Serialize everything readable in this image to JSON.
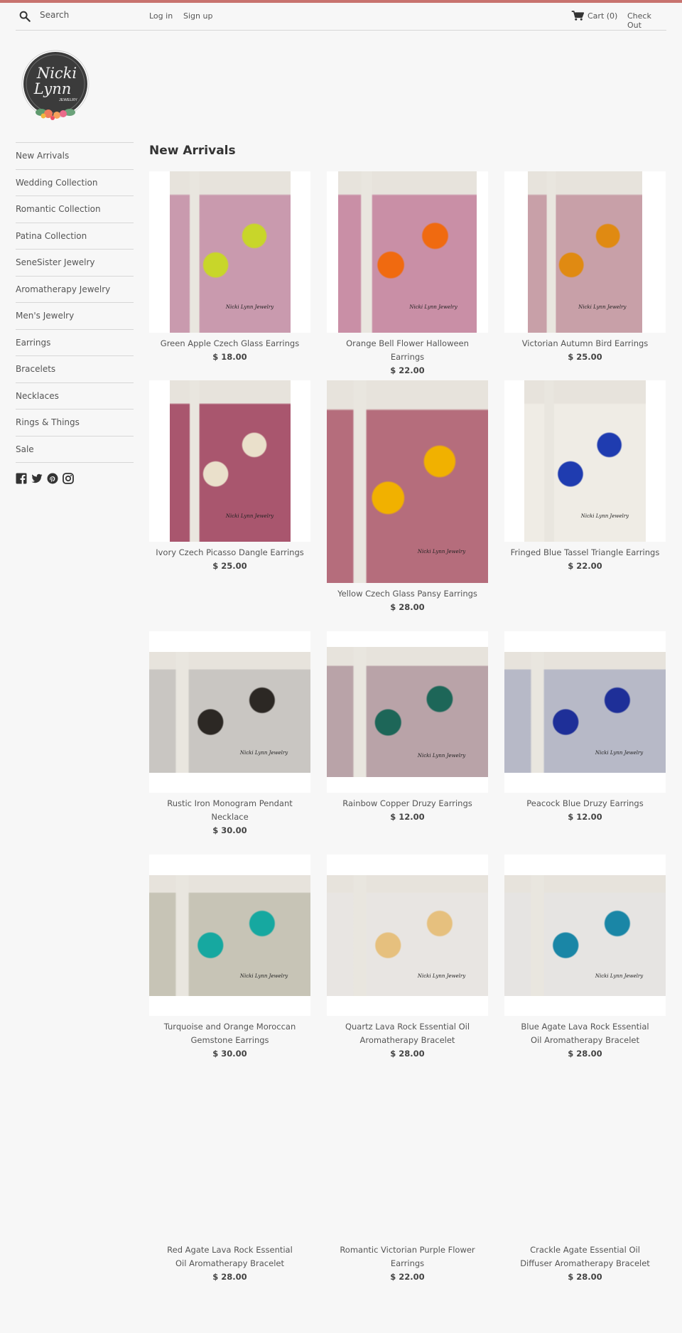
{
  "header": {
    "search_label": "Search",
    "login": "Log in",
    "signup": "Sign up",
    "cart": "Cart (0)",
    "checkout": "Check Out"
  },
  "logo": {
    "line1": "Nicki",
    "line2": "Lynn",
    "line3": "JEWELRY"
  },
  "sidebar": {
    "items": [
      "New Arrivals",
      "Wedding Collection",
      "Romantic Collection",
      "Patina Collection",
      "SeneSister Jewelry",
      "Aromatherapy Jewelry",
      "Men's Jewelry",
      "Earrings",
      "Bracelets",
      "Necklaces",
      "Rings & Things",
      "Sale"
    ],
    "social": [
      "facebook-icon",
      "twitter-icon",
      "pinterest-icon",
      "instagram-icon"
    ]
  },
  "page_title": "New Arrivals",
  "watermark": "Nicki Lynn Jewelry",
  "products": [
    {
      "title": "Green Apple Czech Glass Earrings",
      "price": "$ 18.00",
      "colors": [
        "#c99aae",
        "#c8d62a"
      ]
    },
    {
      "title": "Orange Bell Flower Halloween Earrings",
      "price": "$ 22.00",
      "colors": [
        "#c98fa6",
        "#f06a10"
      ]
    },
    {
      "title": "Victorian Autumn Bird Earrings",
      "price": "$ 25.00",
      "colors": [
        "#c8a0a8",
        "#e08a12"
      ]
    },
    {
      "title": "Ivory Czech Picasso Dangle Earrings",
      "price": "$ 25.00",
      "colors": [
        "#a9566e",
        "#eae0cb"
      ]
    },
    {
      "title": "Yellow Czech Glass Pansy Earrings",
      "price": "$ 28.00",
      "colors": [
        "#b56d7c",
        "#f1b100"
      ]
    },
    {
      "title": "Fringed Blue Tassel Triangle Earrings",
      "price": "$ 22.00",
      "colors": [
        "#efece5",
        "#1f3cb0"
      ]
    },
    {
      "title": "Rustic Iron Monogram Pendant Necklace",
      "price": "$ 30.00",
      "colors": [
        "#c9c6c2",
        "#2c2824"
      ]
    },
    {
      "title": "Rainbow Copper Druzy Earrings",
      "price": "$ 12.00",
      "colors": [
        "#b9a3a8",
        "#1d6658"
      ]
    },
    {
      "title": "Peacock Blue Druzy Earrings",
      "price": "$ 12.00",
      "colors": [
        "#b7b9c7",
        "#1e2f98"
      ]
    },
    {
      "title": "Turquoise and Orange Moroccan Gemstone Earrings",
      "price": "$ 30.00",
      "colors": [
        "#c7c4b6",
        "#16a8a0"
      ]
    },
    {
      "title": "Quartz Lava Rock Essential Oil Aromatherapy Bracelet",
      "price": "$ 28.00",
      "colors": [
        "#e8e5e2",
        "#e6c07e"
      ]
    },
    {
      "title": "Blue Agate Lava Rock Essential Oil Aromatherapy Bracelet",
      "price": "$ 28.00",
      "colors": [
        "#e6e4e2",
        "#1a86a6"
      ]
    },
    {
      "title": "Red Agate Lava Rock Essential Oil Aromatherapy Bracelet",
      "price": "$ 28.00",
      "colors": null
    },
    {
      "title": "Romantic Victorian Purple Flower Earrings",
      "price": "$ 22.00",
      "colors": null
    },
    {
      "title": "Crackle Agate Essential Oil Diffuser Aromatherapy Bracelet",
      "price": "$ 28.00",
      "colors": null
    }
  ]
}
